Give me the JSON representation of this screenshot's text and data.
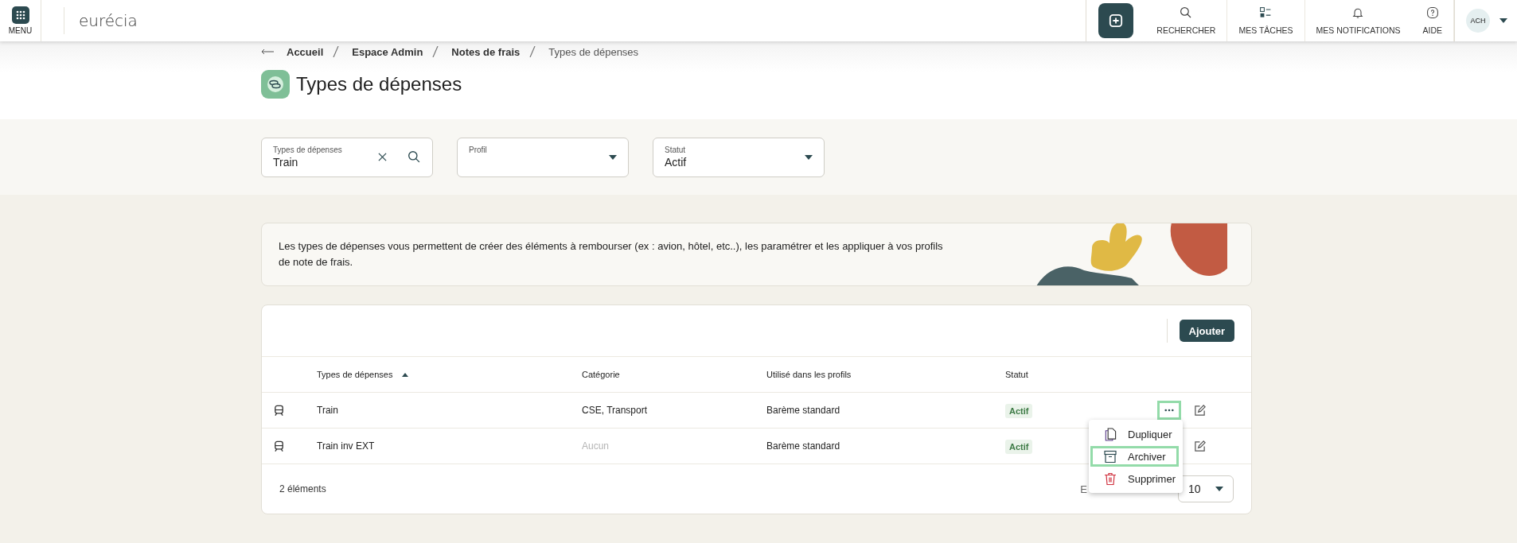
{
  "topbar": {
    "menu_label": "MENU",
    "logo": "eurécia",
    "nav": [
      {
        "kind": "search",
        "label": "RECHERCHER"
      },
      {
        "kind": "tasks",
        "label": "MES TÂCHES"
      },
      {
        "kind": "bell",
        "label": "MES NOTIFICATIONS"
      },
      {
        "kind": "help",
        "label": "AIDE"
      }
    ],
    "avatar": "ACH"
  },
  "breadcrumb": [
    "Accueil",
    "Espace Admin",
    "Notes de frais",
    "Types de dépenses"
  ],
  "title": "Types de dépenses",
  "filters": [
    {
      "kind": "search",
      "label": "Types de dépenses",
      "value": "Train"
    },
    {
      "kind": "select",
      "label": "Profil"
    },
    {
      "kind": "select",
      "label": "Statut",
      "value": "Actif"
    }
  ],
  "banner": "Les types de dépenses vous permettent de créer des éléments à rembourser (ex : avion, hôtel, etc..), les paramétrer et les appliquer à vos profils de note de frais.",
  "add_button": "Ajouter",
  "table": {
    "columns": [
      "Types de dépenses",
      "Catégorie",
      "Utilisé dans les profils",
      "Statut"
    ],
    "rows": [
      {
        "name": "Train",
        "category": "CSE, Transport",
        "category_empty": false,
        "profiles": "Barème standard",
        "status": "Actif",
        "menu_open": true
      },
      {
        "name": "Train inv EXT",
        "category": "Aucun",
        "category_empty": true,
        "profiles": "Barème standard",
        "status": "Actif",
        "menu_open": false
      }
    ]
  },
  "footer": {
    "count": "2 éléments",
    "page_size_label": "E",
    "page_size": "10"
  },
  "row_menu": [
    {
      "kind": "duplicate",
      "label": "Dupliquer",
      "highlighted": false
    },
    {
      "kind": "archive",
      "label": "Archiver",
      "highlighted": true
    },
    {
      "kind": "delete",
      "label": "Supprimer",
      "highlighted": false
    }
  ]
}
